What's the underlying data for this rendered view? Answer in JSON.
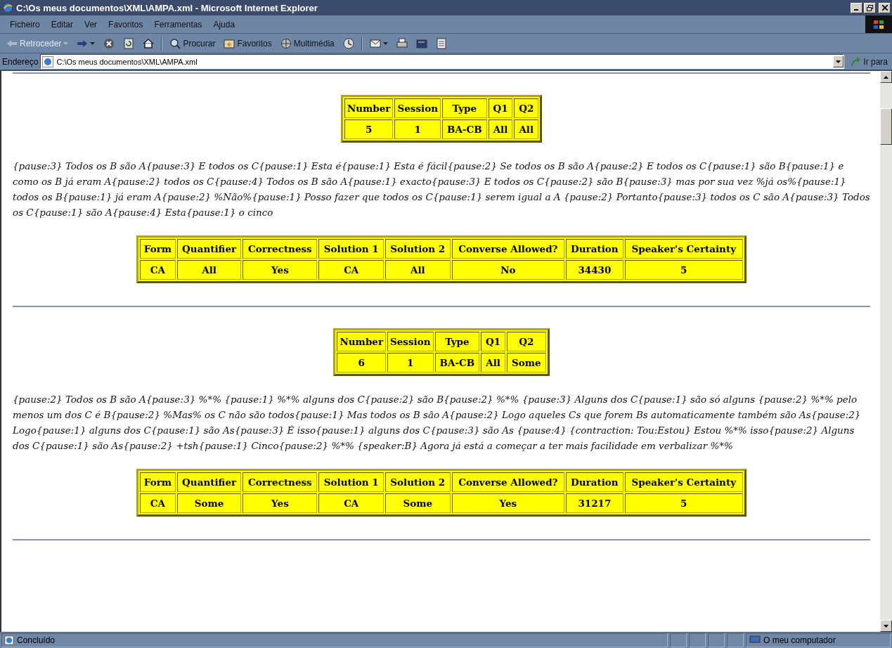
{
  "window": {
    "title": "C:\\Os meus documentos\\XML\\AMPA.xml - Microsoft Internet Explorer"
  },
  "menu": [
    "Ficheiro",
    "Editar",
    "Ver",
    "Favoritos",
    "Ferramentas",
    "Ajuda"
  ],
  "toolbar": [
    {
      "kind": "back",
      "label": "Retroceder",
      "disabled": true
    },
    {
      "kind": "forward"
    },
    {
      "kind": "stop"
    },
    {
      "kind": "refresh"
    },
    {
      "kind": "home"
    },
    {
      "kind": "separator"
    },
    {
      "kind": "search",
      "label": "Procurar"
    },
    {
      "kind": "favorites",
      "label": "Favoritos"
    },
    {
      "kind": "media",
      "label": "Multimédia"
    },
    {
      "kind": "history"
    },
    {
      "kind": "separator"
    },
    {
      "kind": "mail"
    },
    {
      "kind": "print"
    },
    {
      "kind": "edit"
    },
    {
      "kind": "discuss"
    }
  ],
  "address": {
    "label": "Endereço",
    "value": "C:\\Os meus documentos\\XML\\AMPA.xml",
    "go": "Ir para"
  },
  "records": [
    {
      "summary": {
        "columns": [
          "Number",
          "Session",
          "Type",
          "Q1",
          "Q2"
        ],
        "values": [
          "5",
          "1",
          "BA-CB",
          "All",
          "All"
        ]
      },
      "transcript": "{pause:3} Todos os B são A{pause:3} E todos os C{pause:1} Esta é{pause:1} Esta é fácil{pause:2} Se todos os B são A{pause:2} E todos os C{pause:1} são B{pause:1} e como os B já eram A{pause:2} todos os C{pause:4} Todos os B são A{pause:1} exacto{pause:3} E todos os C{pause:2} são B{pause:3} mas por sua vez %já os%{pause:1} todos os B{pause:1} já eram A{pause:2} %Não%{pause:1} Posso fazer que todos os C{pause:1} serem igual a A {pause:2} Portanto{pause:3} todos os C são A{pause:3} Todos os C{pause:1} são A{pause:4} Esta{pause:1} o cinco",
      "details": {
        "columns": [
          "Form",
          "Quantifier",
          "Correctness",
          "Solution 1",
          "Solution 2",
          "Converse Allowed?",
          "Duration",
          "Speaker's Certainty"
        ],
        "values": [
          "CA",
          "All",
          "Yes",
          "CA",
          "All",
          "No",
          "34430",
          "5"
        ]
      }
    },
    {
      "summary": {
        "columns": [
          "Number",
          "Session",
          "Type",
          "Q1",
          "Q2"
        ],
        "values": [
          "6",
          "1",
          "BA-CB",
          "All",
          "Some"
        ]
      },
      "transcript": "{pause:2} Todos os B são A{pause:3} %*% {pause:1} %*% alguns dos C{pause:2} são B{pause:2} %*% {pause:3} Alguns dos C{pause:1} são só alguns {pause:2} %*% pelo menos um dos C é B{pause:2} %Mas% os C não são todos{pause:1} Mas todos os B são A{pause:2} Logo aqueles Cs que forem Bs automaticamente também são As{pause:2} Logo{pause:1} alguns dos C{pause:1} são As{pause:3} É isso{pause:1} alguns dos C{pause:3} são As {pause:4} {contraction: Tou:Estou} Estou %*% isso{pause:2} Alguns dos C{pause:1} são As{pause:2} +tsh{pause:1} Cinco{pause:2} %*% {speaker:B} Agora já está a começar a ter mais facilidade em verbalizar %*%",
      "details": {
        "columns": [
          "Form",
          "Quantifier",
          "Correctness",
          "Solution 1",
          "Solution 2",
          "Converse Allowed?",
          "Duration",
          "Speaker's Certainty"
        ],
        "values": [
          "CA",
          "Some",
          "Yes",
          "CA",
          "Some",
          "Yes",
          "31217",
          "5"
        ]
      }
    }
  ],
  "status_bar": {
    "text": "Concluído",
    "zone": "O meu computador"
  }
}
